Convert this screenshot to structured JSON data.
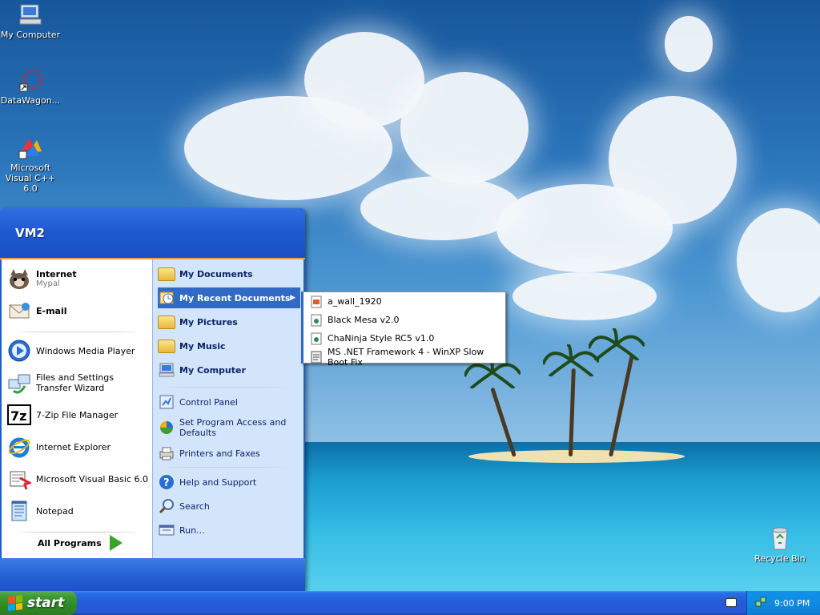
{
  "desktop": {
    "icons": [
      {
        "label": "My Computer",
        "icon": "my-computer-icon"
      },
      {
        "label": "DataWagon...",
        "icon": "datawagon-shortcut-icon"
      },
      {
        "label": "Microsoft Visual C++ 6.0",
        "icon": "visual-cpp-icon"
      },
      {
        "label": "Recycle Bin",
        "icon": "recycle-bin-icon"
      }
    ]
  },
  "start_menu": {
    "user": "VM2",
    "pinned": [
      {
        "label": "Internet",
        "sub": "Mypal",
        "icon": "internet-browser-icon"
      },
      {
        "label": "E-mail",
        "icon": "email-icon"
      }
    ],
    "recent_programs": [
      {
        "label": "Windows Media Player",
        "icon": "media-player-icon"
      },
      {
        "label": "Files and Settings Transfer Wizard",
        "icon": "transfer-wizard-icon"
      },
      {
        "label": "7-Zip File Manager",
        "icon": "7zip-icon"
      },
      {
        "label": "Internet Explorer",
        "icon": "internet-explorer-icon"
      },
      {
        "label": "Microsoft Visual Basic 6.0",
        "icon": "visual-basic-icon"
      },
      {
        "label": "Notepad",
        "icon": "notepad-icon"
      }
    ],
    "all_programs": "All Programs",
    "places": [
      {
        "label": "My Documents",
        "icon": "folder-icon"
      },
      {
        "label": "My Recent Documents",
        "icon": "recent-documents-icon"
      },
      {
        "label": "My Pictures",
        "icon": "pictures-folder-icon"
      },
      {
        "label": "My Music",
        "icon": "music-folder-icon"
      },
      {
        "label": "My Computer",
        "icon": "computer-icon"
      }
    ],
    "system": [
      {
        "label": "Control Panel",
        "icon": "control-panel-icon"
      },
      {
        "label": "Set Program Access and Defaults",
        "icon": "program-defaults-icon"
      },
      {
        "label": "Printers and Faxes",
        "icon": "printer-icon"
      }
    ],
    "help": [
      {
        "label": "Help and Support",
        "icon": "help-icon"
      },
      {
        "label": "Search",
        "icon": "search-icon"
      },
      {
        "label": "Run...",
        "icon": "run-icon"
      }
    ]
  },
  "recent_documents": [
    {
      "label": "a_wall_1920",
      "icon": "image-file-icon"
    },
    {
      "label": "Black Mesa v2.0",
      "icon": "document-icon"
    },
    {
      "label": "ChaNinja Style RC5 v1.0",
      "icon": "document-icon"
    },
    {
      "label": "MS .NET Framework 4 - WinXP Slow Boot Fix",
      "icon": "script-file-icon"
    }
  ],
  "taskbar": {
    "start_label": "start",
    "clock": "9:00 PM"
  },
  "colors": {
    "taskbar_blue": "#245ddb",
    "start_green": "#3c9a33",
    "highlight": "#316ac5",
    "menu_right_bg": "#d3e5fa"
  }
}
